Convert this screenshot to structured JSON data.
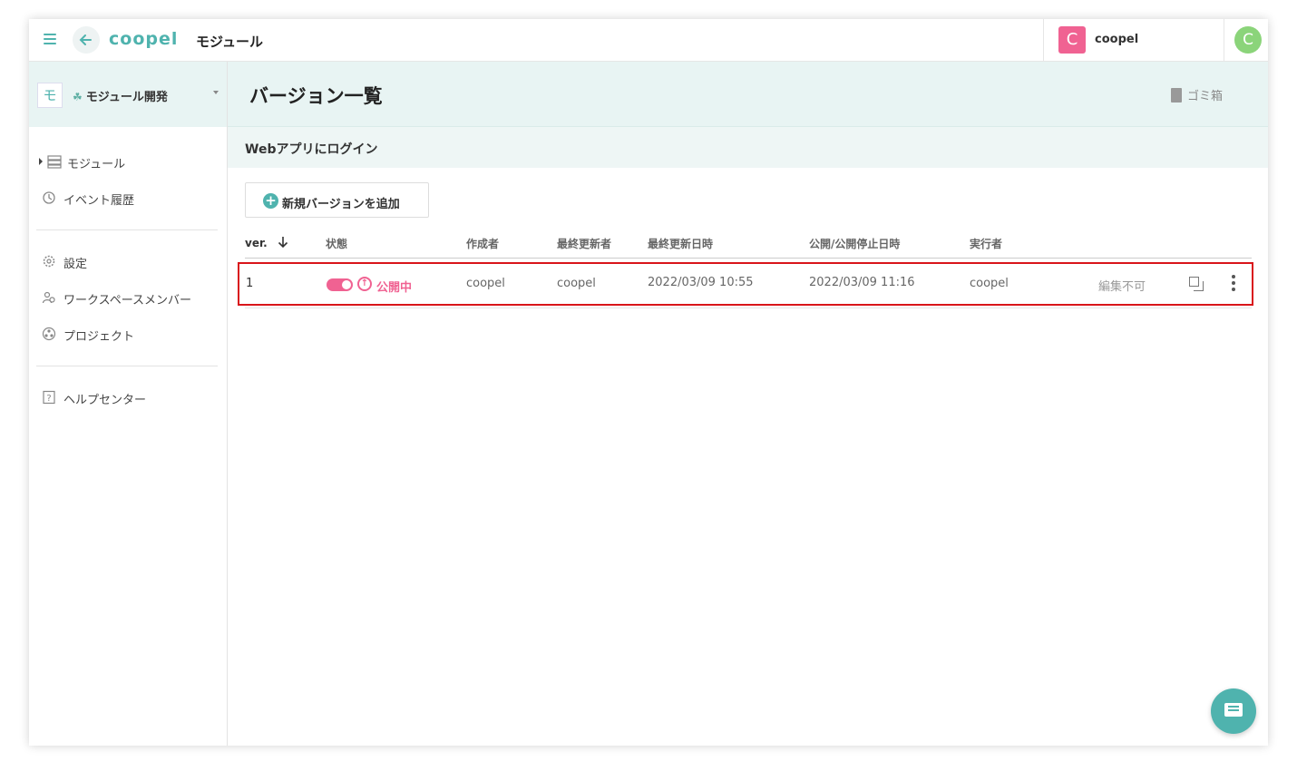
{
  "header": {
    "logo": "coopel",
    "title": "モジュール",
    "workspace": {
      "initial": "C",
      "name": "coopel",
      "color": "#f06292"
    },
    "user": {
      "initial": "C",
      "color": "#8bd47a"
    }
  },
  "sidebar": {
    "project": {
      "badge": "モ",
      "name": "モジュール開発"
    },
    "nav_primary": [
      {
        "label": "モジュール",
        "icon": "server-icon"
      },
      {
        "label": "イベント履歴",
        "icon": "history-icon"
      }
    ],
    "nav_secondary": [
      {
        "label": "設定",
        "icon": "gear-icon"
      },
      {
        "label": "ワークスペースメンバー",
        "icon": "members-icon"
      },
      {
        "label": "プロジェクト",
        "icon": "project-icon"
      }
    ],
    "nav_help": [
      {
        "label": "ヘルプセンター",
        "icon": "help-icon"
      }
    ]
  },
  "main": {
    "page_title": "バージョン一覧",
    "trash_label": "ゴミ箱",
    "module_name": "Webアプリにログイン",
    "add_button_label": "新規バージョンを追加",
    "columns": {
      "version": "ver.",
      "status": "状態",
      "creator": "作成者",
      "updater": "最終更新者",
      "updated_at": "最終更新日時",
      "published_at": "公開/公開停止日時",
      "executor": "実行者"
    },
    "rows": [
      {
        "version": "1",
        "status_label": "公開中",
        "status_on": true,
        "creator": "coopel",
        "updater": "coopel",
        "updated_at": "2022/03/09 10:55",
        "published_at": "2022/03/09 11:16",
        "executor": "coopel",
        "edit_state": "編集不可"
      }
    ]
  },
  "colors": {
    "accent": "#4fb3ae",
    "status_active": "#f06292",
    "highlight": "#d9151a"
  }
}
